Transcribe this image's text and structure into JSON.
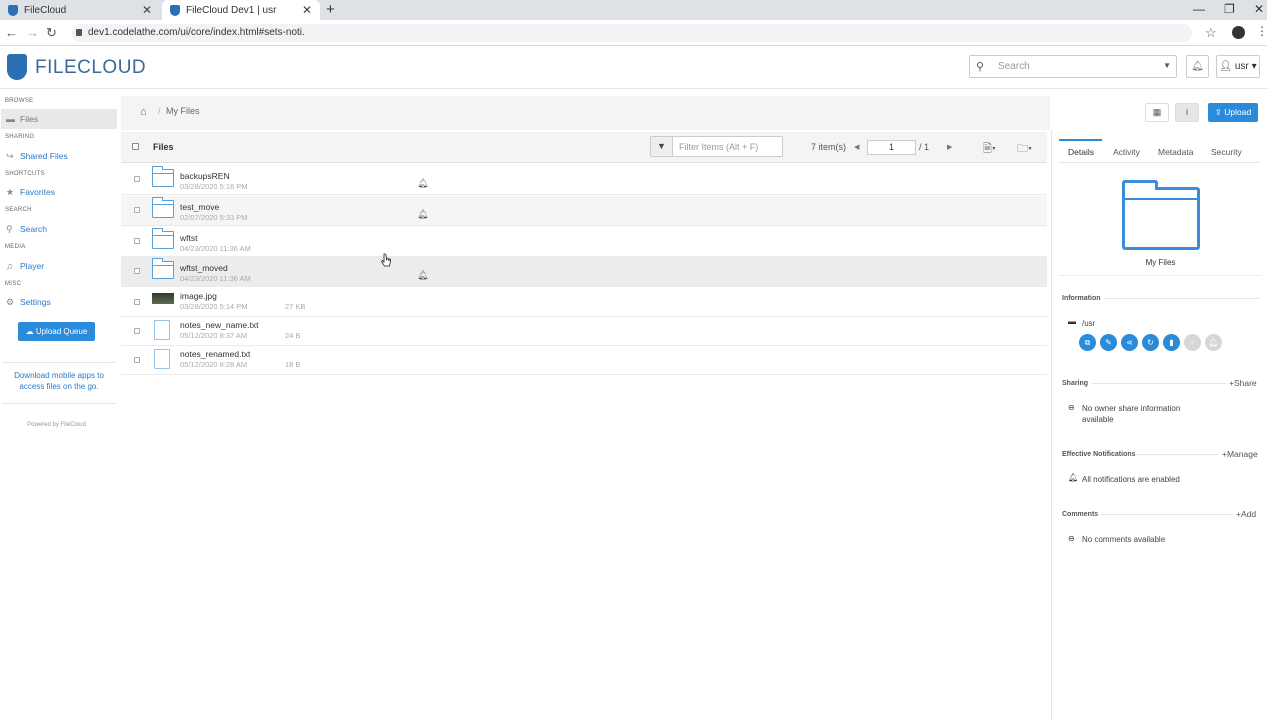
{
  "browser": {
    "tabs": [
      {
        "label": "FileCloud"
      },
      {
        "label": "FileCloud Dev1 | usr"
      }
    ],
    "url": "dev1.codelathe.com/ui/core/index.html#sets-noti."
  },
  "header": {
    "logo": "FILECLOUD",
    "search_placeholder": "Search",
    "user": "usr"
  },
  "sidebar": {
    "sections": {
      "browse": "BROWSE",
      "sharing": "SHARING",
      "shortcuts": "SHORTCUTS",
      "search": "SEARCH",
      "media": "MEDIA",
      "misc": "MISC"
    },
    "items": {
      "files": "Files",
      "shared_files": "Shared Files",
      "favorites": "Favorites",
      "search": "Search",
      "player": "Player",
      "settings": "Settings"
    },
    "upload_queue": "Upload Queue",
    "mobile_apps": "Download mobile apps to access files on the go.",
    "powered_by": "Powered by FileCloud"
  },
  "main": {
    "breadcrumb": "My Files",
    "upload_label": "Upload",
    "list_header": "Files",
    "filter_placeholder": "Filter Items (Alt + F)",
    "item_count": "7 item(s)",
    "page_current": "1",
    "page_total": "/ 1",
    "files": [
      {
        "name": "backupsREN",
        "date": "03/28/2020 5:16 PM",
        "size": "",
        "type": "folder",
        "bell": true
      },
      {
        "name": "test_move",
        "date": "02/07/2020 5:33 PM",
        "size": "",
        "type": "folder",
        "bell": true
      },
      {
        "name": "wftst",
        "date": "04/23/2020 11:36 AM",
        "size": "",
        "type": "folder",
        "bell": false
      },
      {
        "name": "wftst_moved",
        "date": "04/23/2020 11:36 AM",
        "size": "",
        "type": "folder",
        "bell": true
      },
      {
        "name": "image.jpg",
        "date": "03/28/2020 5:14 PM",
        "size": "27 KB",
        "type": "image",
        "bell": false
      },
      {
        "name": "notes_new_name.txt",
        "date": "05/12/2020 8:37 AM",
        "size": "24 B",
        "type": "doc",
        "bell": false
      },
      {
        "name": "notes_renamed.txt",
        "date": "05/12/2020 8:28 AM",
        "size": "18 B",
        "type": "doc",
        "bell": false
      }
    ]
  },
  "details": {
    "tabs": [
      "Details",
      "Activity",
      "Metadata",
      "Security"
    ],
    "folder_label": "My Files",
    "information_title": "Information",
    "path": "/usr",
    "sharing_title": "Sharing",
    "share_action": "Share",
    "sharing_text": "No owner share information available",
    "notifications_title": "Effective Notifications",
    "manage_action": "Manage",
    "notifications_text": "All notifications are enabled",
    "comments_title": "Comments",
    "add_action": "Add",
    "comments_text": "No comments available"
  },
  "colors": {
    "accent": "#2a8bdb",
    "folder": "#3c8dd8",
    "link": "#2a7ac8"
  }
}
